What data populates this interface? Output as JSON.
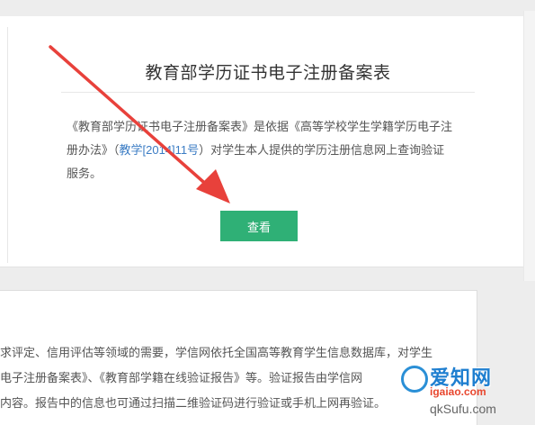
{
  "card": {
    "title": "教育部学历证书电子注册备案表",
    "desc_line1": "《教育部学历证书电子注册备案表》是依据《高等学校学生学籍学历电子注",
    "desc_line2_pre": "册办法》（",
    "desc_link": "教学[2014]11号",
    "desc_line2_post": "）对学生本人提供的学历注册信息网上查询验证",
    "desc_line3": "服务。",
    "button_label": "查看"
  },
  "bottom": {
    "line1": "求评定、信用评估等领域的需要，学信网依托全国高等教育学生信息数据库，对学生",
    "line2": "电子注册备案表》、《教育部学籍在线验证报告》等。验证报告由学信网",
    "line3": "内容。报告中的信息也可通过扫描二维验证码进行验证或手机上网再验证。"
  },
  "watermark": {
    "brand": "爱知网",
    "url": "igaiao.com",
    "url2": "qkSufu.com"
  },
  "colors": {
    "button": "#2fb076",
    "link": "#3b7cc4",
    "arrow": "#e8413b"
  }
}
